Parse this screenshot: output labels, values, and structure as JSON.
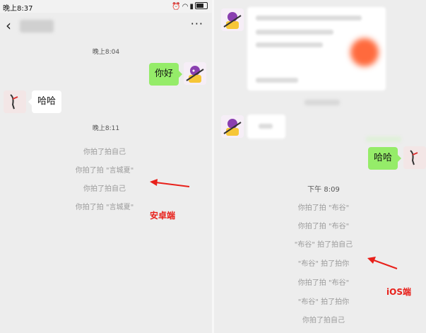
{
  "android": {
    "status": {
      "time": "晚上8:37"
    },
    "timestamps": [
      "晚上8:04",
      "晚上8:11"
    ],
    "messages": {
      "me": "你好",
      "other": "哈哈"
    },
    "system": [
      "你拍了拍自己",
      "你拍了拍 \"言城夏\"",
      "你拍了拍自己",
      "你拍了拍 \"言城夏\""
    ],
    "label": "安卓端"
  },
  "ios": {
    "timestamp": "下午 8:09",
    "messages": {
      "me": "哈哈"
    },
    "system": [
      "你拍了拍 \"布谷\"",
      "你拍了拍 \"布谷\"",
      "\"布谷\" 拍了拍自己",
      "\"布谷\" 拍了拍你",
      "你拍了拍 \"布谷\"",
      "\"布谷\" 拍了拍你",
      "你拍了拍自己"
    ],
    "label": "iOS端"
  },
  "colors": {
    "annotation": "#e8201a",
    "bubble_green": "#95ec69",
    "background": "#ededed"
  }
}
